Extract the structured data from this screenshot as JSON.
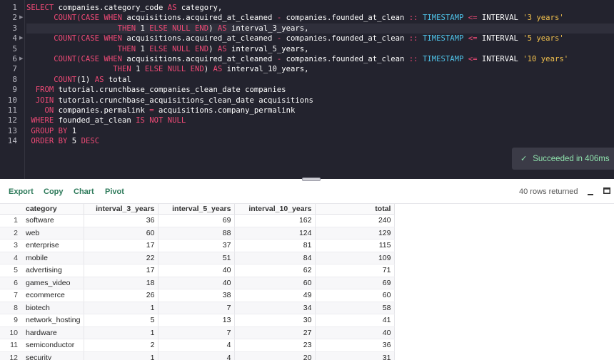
{
  "editor": {
    "line_numbers": [
      "1",
      "2",
      "3",
      "4",
      "5",
      "6",
      "7",
      "8",
      "9",
      "10",
      "11",
      "12",
      "13",
      "14"
    ],
    "lines": [
      [
        {
          "t": "kw",
          "v": "SELECT"
        },
        {
          "t": "p",
          "v": " companies.category_code "
        },
        {
          "t": "kw",
          "v": "AS"
        },
        {
          "t": "p",
          "v": " category,"
        }
      ],
      [
        {
          "t": "p",
          "v": "      "
        },
        {
          "t": "kw",
          "v": "COUNT(CASE WHEN"
        },
        {
          "t": "p",
          "v": " acquisitions.acquired_at_cleaned "
        },
        {
          "t": "op",
          "v": "-"
        },
        {
          "t": "p",
          "v": " companies.founded_at_clean "
        },
        {
          "t": "op",
          "v": "::"
        },
        {
          "t": "p",
          "v": " "
        },
        {
          "t": "ty",
          "v": "TIMESTAMP"
        },
        {
          "t": "p",
          "v": " "
        },
        {
          "t": "op",
          "v": "<="
        },
        {
          "t": "p",
          "v": " INTERVAL "
        },
        {
          "t": "st",
          "v": "'3 years'"
        }
      ],
      [
        {
          "t": "p",
          "v": "                    "
        },
        {
          "t": "kw",
          "v": "THEN"
        },
        {
          "t": "p",
          "v": " 1 "
        },
        {
          "t": "kw",
          "v": "ELSE NULL END"
        },
        {
          "t": "p",
          "v": ") "
        },
        {
          "t": "kw",
          "v": "AS"
        },
        {
          "t": "p",
          "v": " interval_3_years,"
        }
      ],
      [
        {
          "t": "p",
          "v": "      "
        },
        {
          "t": "kw",
          "v": "COUNT(CASE WHEN"
        },
        {
          "t": "p",
          "v": " acquisitions.acquired_at_cleaned "
        },
        {
          "t": "op",
          "v": "-"
        },
        {
          "t": "p",
          "v": " companies.founded_at_clean "
        },
        {
          "t": "op",
          "v": "::"
        },
        {
          "t": "p",
          "v": " "
        },
        {
          "t": "ty",
          "v": "TIMESTAMP"
        },
        {
          "t": "p",
          "v": " "
        },
        {
          "t": "op",
          "v": "<="
        },
        {
          "t": "p",
          "v": " INTERVAL "
        },
        {
          "t": "st",
          "v": "'5 years'"
        }
      ],
      [
        {
          "t": "p",
          "v": "                    "
        },
        {
          "t": "kw",
          "v": "THEN"
        },
        {
          "t": "p",
          "v": " 1 "
        },
        {
          "t": "kw",
          "v": "ELSE NULL END"
        },
        {
          "t": "p",
          "v": ") "
        },
        {
          "t": "kw",
          "v": "AS"
        },
        {
          "t": "p",
          "v": " interval_5_years,"
        }
      ],
      [
        {
          "t": "p",
          "v": "      "
        },
        {
          "t": "kw",
          "v": "COUNT(CASE WHEN"
        },
        {
          "t": "p",
          "v": " acquisitions.acquired_at_cleaned "
        },
        {
          "t": "op",
          "v": "-"
        },
        {
          "t": "p",
          "v": " companies.founded_at_clean "
        },
        {
          "t": "op",
          "v": "::"
        },
        {
          "t": "p",
          "v": " "
        },
        {
          "t": "ty",
          "v": "TIMESTAMP"
        },
        {
          "t": "p",
          "v": " "
        },
        {
          "t": "op",
          "v": "<="
        },
        {
          "t": "p",
          "v": " INTERVAL "
        },
        {
          "t": "st",
          "v": "'10 years'"
        }
      ],
      [
        {
          "t": "p",
          "v": "                   "
        },
        {
          "t": "kw",
          "v": "THEN"
        },
        {
          "t": "p",
          "v": " 1 "
        },
        {
          "t": "kw",
          "v": "ELSE NULL END"
        },
        {
          "t": "p",
          "v": ") "
        },
        {
          "t": "kw",
          "v": "AS"
        },
        {
          "t": "p",
          "v": " interval_10_years,"
        }
      ],
      [
        {
          "t": "p",
          "v": "      "
        },
        {
          "t": "kw",
          "v": "COUNT"
        },
        {
          "t": "p",
          "v": "(1) "
        },
        {
          "t": "kw",
          "v": "AS"
        },
        {
          "t": "p",
          "v": " total"
        }
      ],
      [
        {
          "t": "p",
          "v": "  "
        },
        {
          "t": "kw",
          "v": "FROM"
        },
        {
          "t": "p",
          "v": " tutorial.crunchbase_companies_clean_date companies"
        }
      ],
      [
        {
          "t": "p",
          "v": "  "
        },
        {
          "t": "kw",
          "v": "JOIN"
        },
        {
          "t": "p",
          "v": " tutorial.crunchbase_acquisitions_clean_date acquisitions"
        }
      ],
      [
        {
          "t": "p",
          "v": "    "
        },
        {
          "t": "kw",
          "v": "ON"
        },
        {
          "t": "p",
          "v": " companies.permalink "
        },
        {
          "t": "op",
          "v": "="
        },
        {
          "t": "p",
          "v": " acquisitions.company_permalink"
        }
      ],
      [
        {
          "t": "p",
          "v": " "
        },
        {
          "t": "kw",
          "v": "WHERE"
        },
        {
          "t": "p",
          "v": " founded_at_clean "
        },
        {
          "t": "kw",
          "v": "IS NOT NULL"
        }
      ],
      [
        {
          "t": "p",
          "v": " "
        },
        {
          "t": "kw",
          "v": "GROUP BY"
        },
        {
          "t": "p",
          "v": " 1"
        }
      ],
      [
        {
          "t": "p",
          "v": " "
        },
        {
          "t": "kw",
          "v": "ORDER BY"
        },
        {
          "t": "p",
          "v": " 5 "
        },
        {
          "t": "kw",
          "v": "DESC"
        }
      ]
    ]
  },
  "toast": {
    "text": "Succeeded in 406ms"
  },
  "toolbar": {
    "export": "Export",
    "copy": "Copy",
    "chart": "Chart",
    "pivot": "Pivot",
    "rows_returned": "40 rows returned"
  },
  "table": {
    "columns": [
      "category",
      "interval_3_years",
      "interval_5_years",
      "interval_10_years",
      "total"
    ],
    "rows": [
      [
        "1",
        "software",
        "36",
        "69",
        "162",
        "240"
      ],
      [
        "2",
        "web",
        "60",
        "88",
        "124",
        "129"
      ],
      [
        "3",
        "enterprise",
        "17",
        "37",
        "81",
        "115"
      ],
      [
        "4",
        "mobile",
        "22",
        "51",
        "84",
        "109"
      ],
      [
        "5",
        "advertising",
        "17",
        "40",
        "62",
        "71"
      ],
      [
        "6",
        "games_video",
        "18",
        "40",
        "60",
        "69"
      ],
      [
        "7",
        "ecommerce",
        "26",
        "38",
        "49",
        "60"
      ],
      [
        "8",
        "biotech",
        "1",
        "7",
        "34",
        "58"
      ],
      [
        "9",
        "network_hosting",
        "5",
        "13",
        "30",
        "41"
      ],
      [
        "10",
        "hardware",
        "1",
        "7",
        "27",
        "40"
      ],
      [
        "11",
        "semiconductor",
        "2",
        "4",
        "23",
        "36"
      ],
      [
        "12",
        "security",
        "1",
        "4",
        "20",
        "31"
      ]
    ]
  }
}
